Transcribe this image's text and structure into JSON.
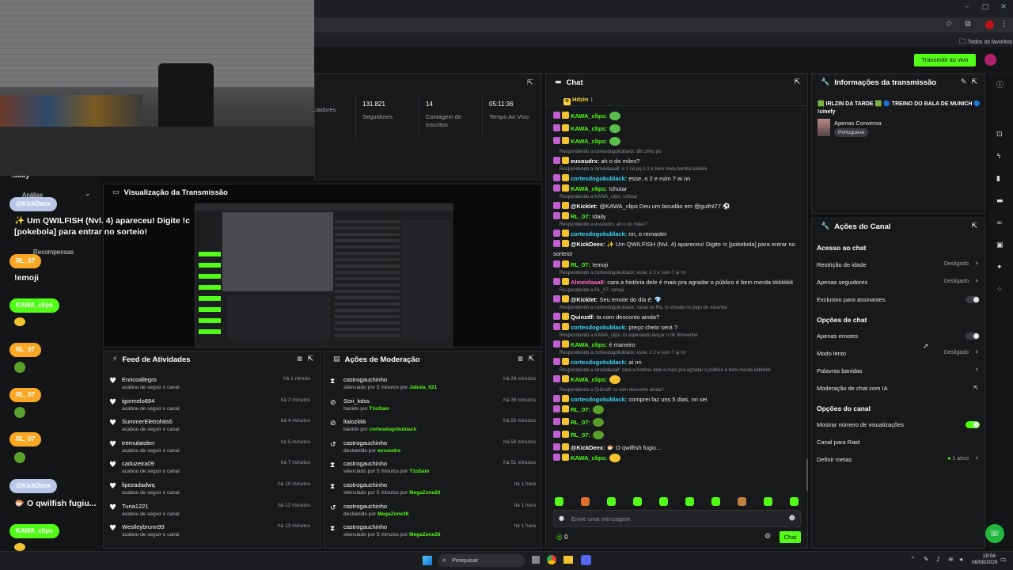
{
  "browser": {
    "bookmarks_label": "Todos os favoritos"
  },
  "header": {
    "go_live": "Transmitir ao vivo"
  },
  "stats": {
    "items": [
      {
        "value": "",
        "label": "...tadores"
      },
      {
        "value": "131.821",
        "label": "Seguidores"
      },
      {
        "value": "14",
        "label": "Contagem de Inscritos"
      },
      {
        "value": "05:11:36",
        "label": "Tempo Ao Vivo"
      }
    ]
  },
  "preview": {
    "title": "Visualização da Transmissão"
  },
  "feed": {
    "title": "Feed de Atividades",
    "items": [
      {
        "name": "Enricoallegro",
        "action": "acabou de seguir o canal",
        "time": "há 1 minuto"
      },
      {
        "name": "igormelo894",
        "action": "acabou de seguir o canal",
        "time": "há 2 minutos"
      },
      {
        "name": "SummerEletrohits6",
        "action": "acabou de seguir o canal",
        "time": "há 4 minutos"
      },
      {
        "name": "tremulatolen",
        "action": "acabou de seguir o canal",
        "time": "há 5 minutos"
      },
      {
        "name": "caduzeira09",
        "action": "acabou de seguir o canal",
        "time": "há 7 minutos"
      },
      {
        "name": "lipezadadwq",
        "action": "acabou de seguir o canal",
        "time": "há 10 minutos"
      },
      {
        "name": "Tuna1221",
        "action": "acabou de seguir o canal",
        "time": "há 12 minutos"
      },
      {
        "name": "Weslleybrunn99",
        "action": "acabou de seguir o canal",
        "time": "há 13 minutos"
      }
    ]
  },
  "moderation": {
    "title": "Ações de Moderação",
    "items": [
      {
        "icon": "hourglass-icon",
        "name": "castrogauchinho",
        "action": "silenciado por 5 minutos por",
        "by": "Jabula_021",
        "time": "há 24 minutos"
      },
      {
        "icon": "ban-icon",
        "name": "Sori_kdss",
        "action": "banido por",
        "by": "T1oSam",
        "time": "há 39 minutos"
      },
      {
        "icon": "ban-icon",
        "name": "ltaiozkkk",
        "action": "banido por",
        "by": "cortesdogokublack",
        "time": "há 50 minutos"
      },
      {
        "icon": "undo-icon",
        "name": "castrogauchinho",
        "action": "desbanido por",
        "by": "eusoudrx",
        "time": "há 50 minutos"
      },
      {
        "icon": "hourglass-icon",
        "name": "castrogauchinho",
        "action": "silenciado por 5 minutos por",
        "by": "T1oSam",
        "time": "há 51 minutos"
      },
      {
        "icon": "hourglass-icon",
        "name": "castrogauchinho",
        "action": "silenciado por 5 minutos por",
        "by": "MegaZone26",
        "time": "há 1 hora"
      },
      {
        "icon": "undo-icon",
        "name": "castrogauchinho",
        "action": "desbanido por",
        "by": "MegaZone26",
        "time": "há 1 hora"
      },
      {
        "icon": "hourglass-icon",
        "name": "castrogauchinho",
        "action": "silenciado por 5 minutos por",
        "by": "MegaZone26",
        "time": "há 1 hora"
      }
    ]
  },
  "chat": {
    "title": "Chat",
    "top_user": "Hdzin",
    "top_count": "1",
    "input_placeholder": "Envie uma mensagem",
    "send_label": "Chat",
    "points": "0",
    "lines": [
      {
        "reply": "",
        "user": "KAWA_clips",
        "color": "#53fc18",
        "text": "",
        "emote": true
      },
      {
        "reply": "",
        "user": "KAWA_clips",
        "color": "#53fc18",
        "text": "",
        "emote": true
      },
      {
        "reply": "",
        "user": "KAWA_clips",
        "color": "#53fc18",
        "text": "",
        "emote": true
      },
      {
        "reply": "Respondendo a cortesdogokublack: 88 conto po",
        "user": "eusoudrx",
        "color": "#ffffff",
        "text": " ah o do miles?"
      },
      {
        "reply": "Respondendo a Almeidaaa8: o 1 né pq o 2 é bem mela bomba kkkkkk",
        "user": "cortesdogokublack",
        "color": "#3ad7f5",
        "text": " esse, o 2 e ruim ? ai nn"
      },
      {
        "reply": "",
        "user": "KAWA_clips",
        "color": "#53fc18",
        "text": " !chutar"
      },
      {
        "reply": "Respondendo a KAWA_clips: !chutar",
        "user": "@Kicklet",
        "color": "#ffffff",
        "text": " @KAWA_clips Deu um bicudão em @guifnl77 ⚽"
      },
      {
        "reply": "",
        "user": "RL_07",
        "color": "#53fc18",
        "text": " !daily"
      },
      {
        "reply": "Respondendo a eusoudrx: ah o do miles?",
        "user": "cortesdogokublack",
        "color": "#3ad7f5",
        "text": " nn, o remaster"
      },
      {
        "reply": "",
        "user": "@KickDeex",
        "color": "#ffffff",
        "text": " ✨ Um QWILFISH (Nvl. 4) apareceu! Digite !c [pokebola] para entrar no"
      },
      {
        "reply": "",
        "user": "",
        "color": "#ffffff",
        "text": "sorteio!"
      },
      {
        "reply": "",
        "user": "RL_07",
        "color": "#53fc18",
        "text": " !emoji"
      },
      {
        "reply": "Respondendo a cortesdogokublack: esse, o 2 e ruim ? ai nn",
        "user": "Almeidaaa8",
        "color": "#ff66c4",
        "text": " cara a história dele é mais pra agradar o público é bem merda kkkkkkk"
      },
      {
        "reply": "Respondendo a RL_07: !emoji",
        "user": "@Kicklet",
        "color": "#ffffff",
        "text": " Seu emote do dia é: 💎"
      },
      {
        "reply": "Respondendo a cortesdogokublack: canal do fifa, to viciado no jogo do miranha",
        "user": "Quinzdf",
        "color": "#ffffff",
        "text": " ta com desconto ainda?"
      },
      {
        "reply": "",
        "user": "cortesdogokublack",
        "color": "#3ad7f5",
        "text": " preço cheio será ?"
      },
      {
        "reply": "Respondendo a KAWA_clips: to esperando lançar o do Wolverine",
        "user": "KAWA_clips",
        "color": "#53fc18",
        "text": " é maneiro"
      },
      {
        "reply": "Respondendo a cortesdogokublack: esse, o 2 e ruim ? ai nn",
        "user": "cortesdogokublack",
        "color": "#3ad7f5",
        "text": " ai nn"
      },
      {
        "reply": "Respondendo a Almeidaaa8: cara a história dele é mais pra agradar o público é bem merda kkkkkkk",
        "user": "KAWA_clips",
        "color": "#53fc18",
        "text": "",
        "emote": true
      },
      {
        "reply": "Respondendo a Quinzdf: ta com desconto ainda?",
        "user": "cortesdogokublack",
        "color": "#3ad7f5",
        "text": " comprei faz uns 5 dias, nn sei"
      },
      {
        "reply": "",
        "user": "RL_07",
        "color": "#53fc18",
        "text": "",
        "emote": true
      },
      {
        "reply": "",
        "user": "RL_07",
        "color": "#53fc18",
        "text": "",
        "emote": true
      },
      {
        "reply": "",
        "user": "RL_07",
        "color": "#53fc18",
        "text": "",
        "emote": true
      },
      {
        "reply": "",
        "user": "@KickDeex",
        "color": "#ffffff",
        "text": " 🐡 O qwilfish fugiu..."
      },
      {
        "reply": "",
        "user": "KAWA_clips",
        "color": "#53fc18",
        "text": "",
        "emote": true
      }
    ]
  },
  "stream_info": {
    "title": "Informações da transmissão",
    "stream_title": "🟩 IRLZIN DA TARDE 🟩 🔵 TREINO DO BALA DE MUNICH 🔵",
    "stream_title2": "!cinefy",
    "category": "Apenas Conversa",
    "language": "Portuguese"
  },
  "channel_actions": {
    "title": "Ações do Canal",
    "sections": [
      {
        "title": "Acesso ao chat"
      },
      {
        "title": "Opções de chat"
      },
      {
        "title": "Opções do canal"
      }
    ],
    "age_restriction": {
      "label": "Restrição de idade",
      "value": "Desligado"
    },
    "followers_only": {
      "label": "Apenas seguidores",
      "value": "Desligado"
    },
    "subs_only": {
      "label": "Exclusivo para assinantes"
    },
    "emotes_only": {
      "label": "Apenas emotes"
    },
    "slow_mode": {
      "label": "Modo lento",
      "value": "Desligado"
    },
    "banned_words": {
      "label": "Palavras banidas"
    },
    "ai_moderation": {
      "label": "Moderação de chat com IA"
    },
    "show_viewers": {
      "label": "Mostrar número de visualizações"
    },
    "raid_channel": {
      "label": "Canal para Raid"
    },
    "goals": {
      "label": "Definir metas",
      "value": "1 ativo"
    }
  },
  "overlay": {
    "line1": "✨ Um QWILFISH (Nvl. 4) apareceu! Digite !c",
    "line2": "[pokebola] para entrar no sorteio!",
    "emoji_cmd": "!emoji",
    "fled": "🐡 O qwilfish fugiu...",
    "user_kickdeex": "@KickDeex",
    "user_rl": "RL_07",
    "user_kawa": "KAWA_clips",
    "sidebar_daily": "!daily",
    "sidebar_analise": "Análise",
    "sidebar_recompensas": "Recompensas"
  },
  "taskbar": {
    "search": "Pesquisar",
    "time": "18:56",
    "date": "06/08/2026"
  }
}
